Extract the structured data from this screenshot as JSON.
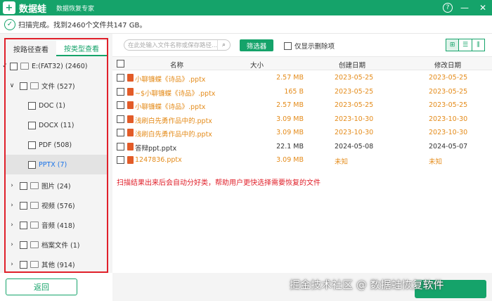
{
  "titlebar": {
    "logo_glyph": "+",
    "app_title": "数据蛙",
    "subtitle": "数据恢复专家",
    "help_glyph": "?",
    "min_glyph": "—",
    "close_glyph": "✕"
  },
  "status": {
    "check_glyph": "✓",
    "text": "扫描完成。找到2460个文件共147 GB。"
  },
  "sidebar": {
    "tab_path": "按路径查看",
    "tab_type": "按类型查看",
    "tree": [
      {
        "label": "E:(FAT32) (2460)",
        "caret": "✓"
      },
      {
        "label": "文件 (527)",
        "caret": "∨"
      },
      {
        "label": "DOC (1)",
        "caret": ""
      },
      {
        "label": "DOCX (11)",
        "caret": ""
      },
      {
        "label": "PDF (508)",
        "caret": ""
      },
      {
        "label": "PPTX (7)",
        "caret": ""
      },
      {
        "label": "图片 (24)",
        "caret": "›"
      },
      {
        "label": "视频 (576)",
        "caret": "›"
      },
      {
        "label": "音频 (418)",
        "caret": "›"
      },
      {
        "label": "档案文件 (1)",
        "caret": "›"
      },
      {
        "label": "其他 (914)",
        "caret": "›"
      }
    ]
  },
  "back_button": "返回",
  "toolbar": {
    "search_placeholder": "在此处输入文件名称或保存路径...",
    "search_icon": "⌕",
    "filter_label": "筛选器",
    "only_deleted_label": "仅显示删除项",
    "view_icons": [
      "⊞",
      "☰",
      "⫼"
    ]
  },
  "table": {
    "columns": {
      "name": "名称",
      "size": "大小",
      "created": "创建日期",
      "modified": "修改日期"
    },
    "rows": [
      {
        "name": "小聊镰蝶《诗品》.pptx",
        "size": "2.57 MB",
        "created": "2023-05-25",
        "modified": "2023-05-25",
        "highlight": true
      },
      {
        "name": "~$小聊镰蝶《诗品》.pptx",
        "size": "165  B",
        "created": "2023-05-25",
        "modified": "2023-05-25",
        "highlight": true
      },
      {
        "name": "小聊镰蝶《诗品》.pptx",
        "size": "2.57 MB",
        "created": "2023-05-25",
        "modified": "2023-05-25",
        "highlight": true
      },
      {
        "name": "浅刷白先勇作品中的.pptx",
        "size": "3.09 MB",
        "created": "2023-10-30",
        "modified": "2023-10-30",
        "highlight": true
      },
      {
        "name": "浅刷白先勇作品中的.pptx",
        "size": "3.09 MB",
        "created": "2023-10-30",
        "modified": "2023-10-30",
        "highlight": true
      },
      {
        "name": "答辩ppt.pptx",
        "size": "22.1 MB",
        "created": "2024-05-08",
        "modified": "2024-05-07",
        "highlight": false
      },
      {
        "name": "1247836.pptx",
        "size": "3.09 MB",
        "created": "未知",
        "modified": "未知",
        "highlight": true
      }
    ]
  },
  "annotation": "扫描结果出来后会自动分好类，帮助用户更快选择需要恢复的文件",
  "watermark": "掘金技术社区 @ 数据蛙恢复软件"
}
